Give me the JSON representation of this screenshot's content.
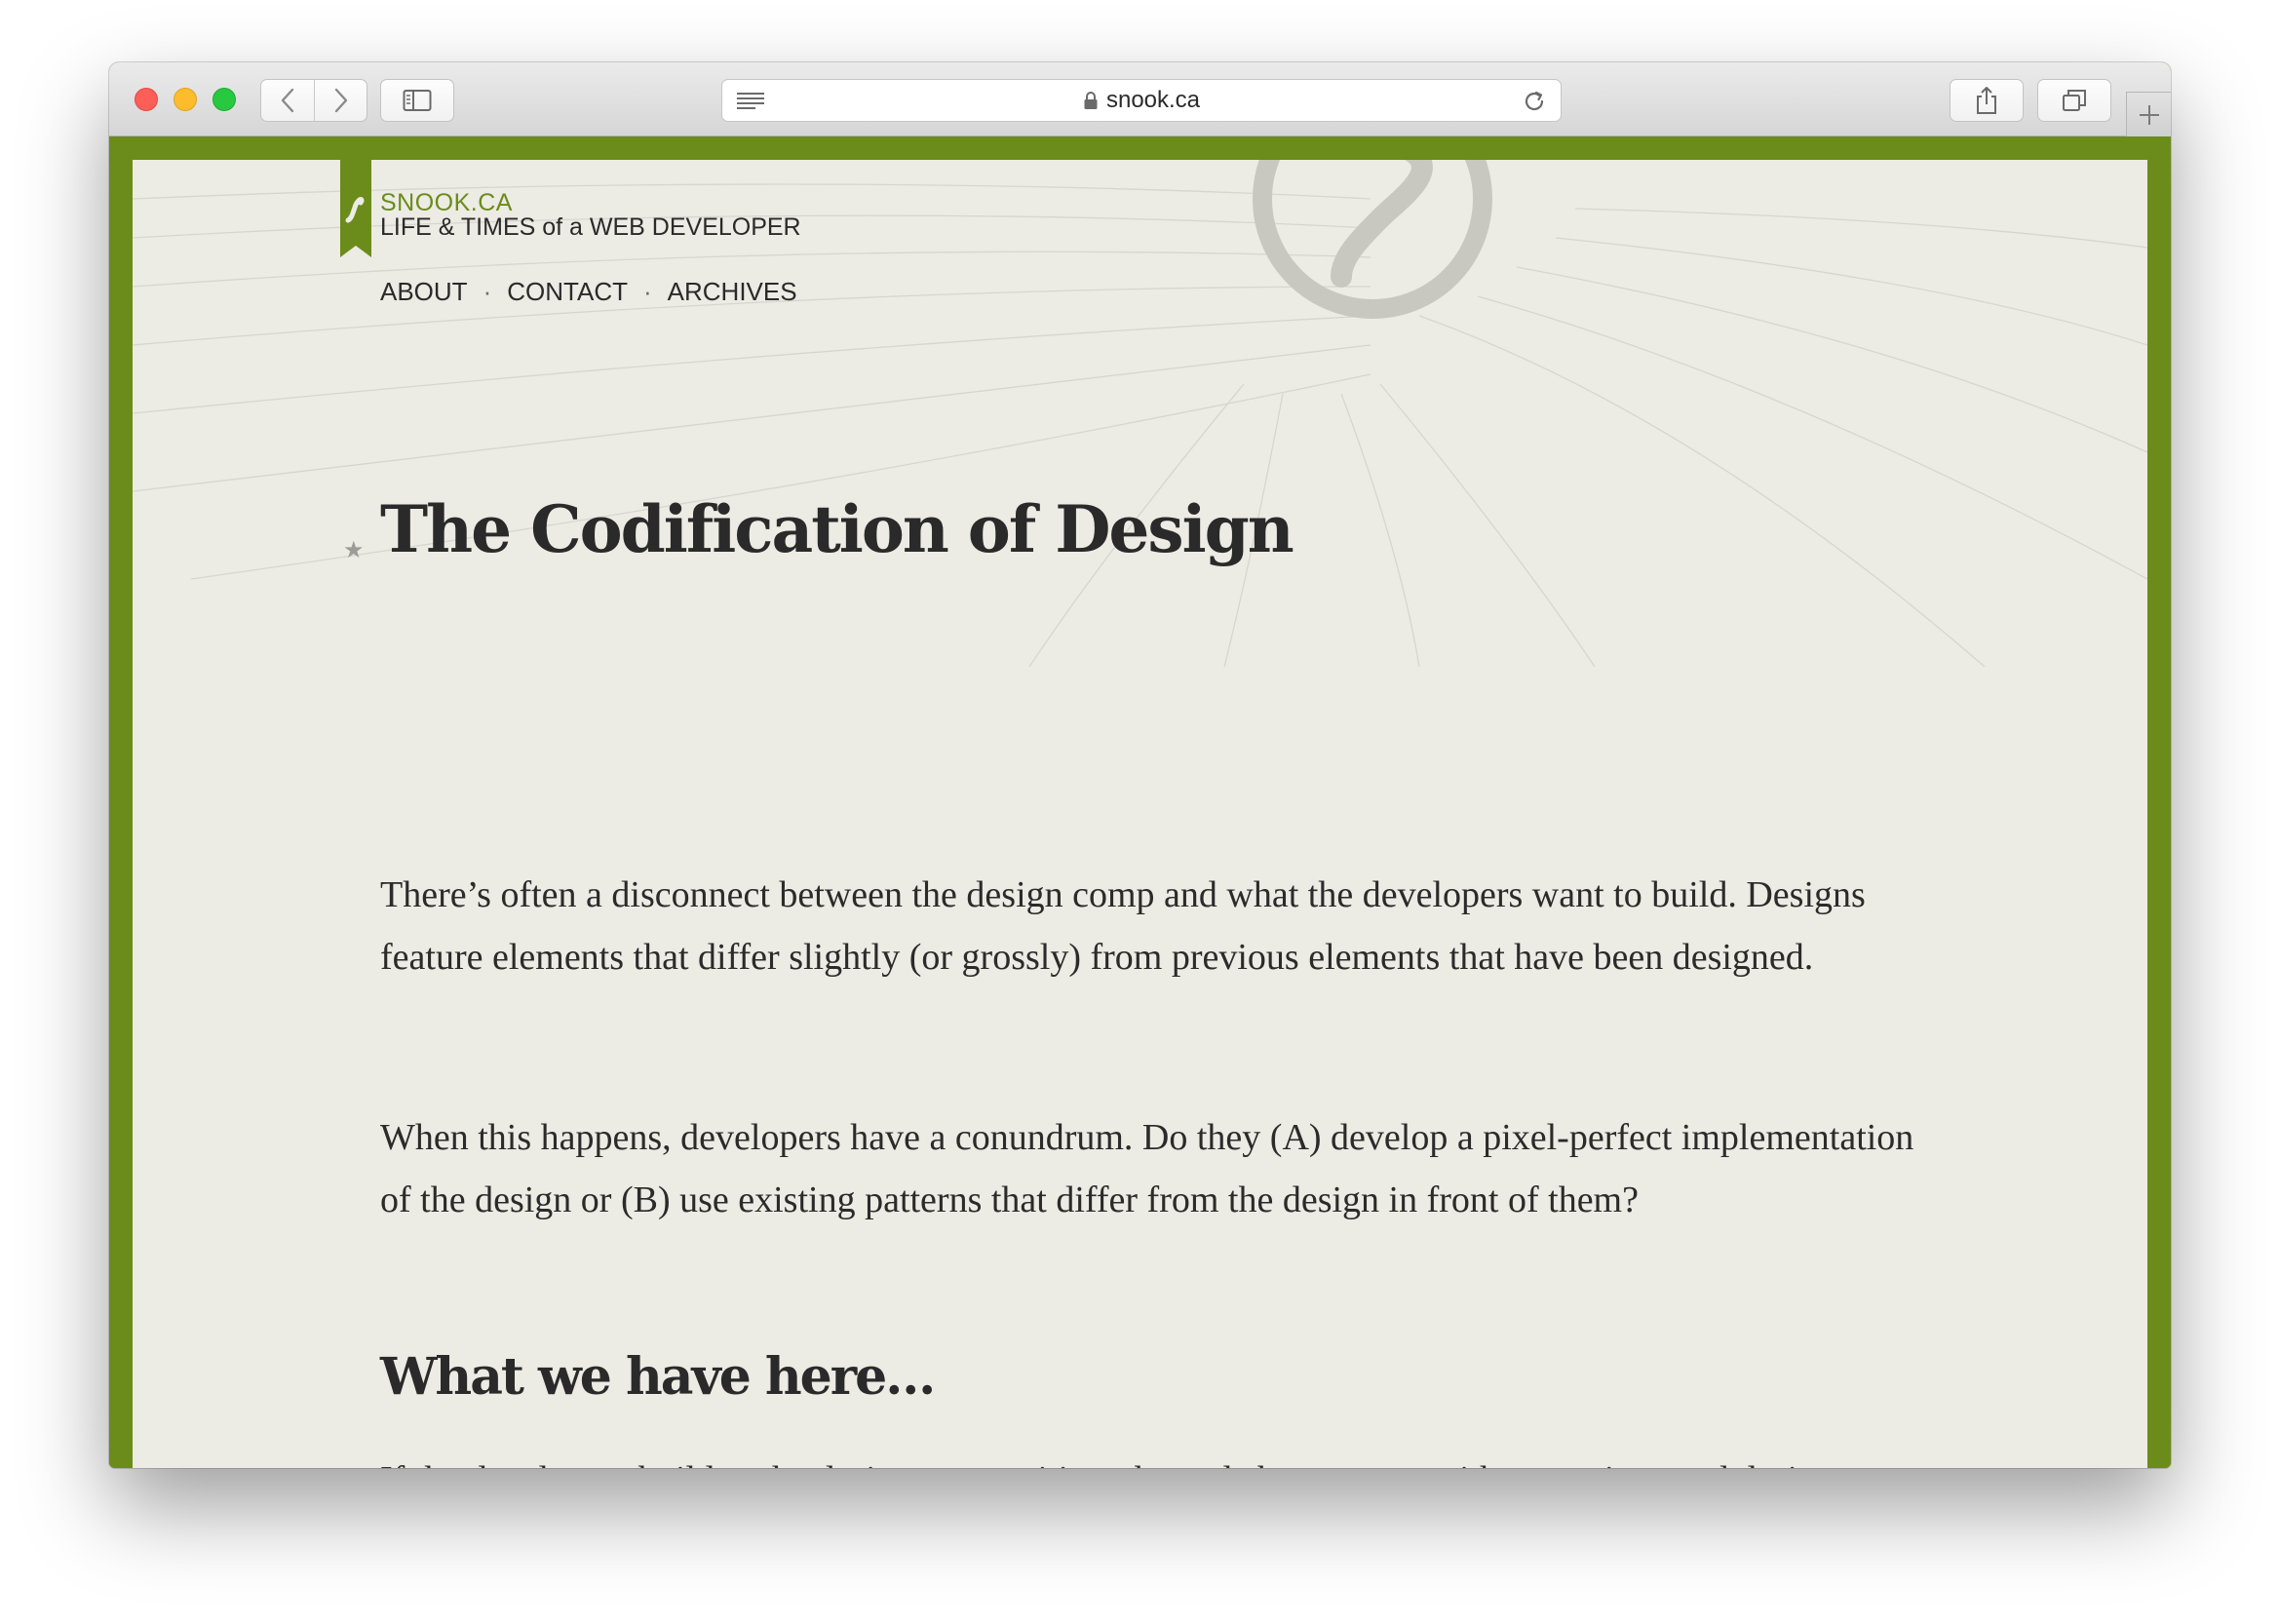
{
  "browser": {
    "url": "snook.ca",
    "icons": {
      "back": "chevron-left-icon",
      "forward": "chevron-right-icon",
      "sidebar": "sidebar-icon",
      "reader": "reader-icon",
      "lock": "lock-icon",
      "reload": "reload-icon",
      "share": "share-icon",
      "tabs": "tabs-icon",
      "new_tab": "plus-icon"
    }
  },
  "site": {
    "name": "SNOOK.CA",
    "tagline": "LIFE & TIMES of a WEB DEVELOPER",
    "accent_color": "#6b8c1a",
    "nav": [
      "ABOUT",
      "CONTACT",
      "ARCHIVES"
    ],
    "nav_separator": "·"
  },
  "article": {
    "title": "The Codification of Design",
    "star_icon": "star-icon",
    "paragraphs": [
      "There’s often a disconnect between the design comp and what the developers want to build. Designs feature elements that differ slightly (or grossly) from previous elements that have been designed.",
      "When this happens, developers have a conundrum. Do they (A) develop a pixel-perfect implementation of the design or (B) use existing patterns that differ from the design in front of them?"
    ],
    "subheading": "What we have here…",
    "paragraph_after_subheading": "If the developers build to the design composition, the code base grows with exceptions and design inconsistencies."
  }
}
